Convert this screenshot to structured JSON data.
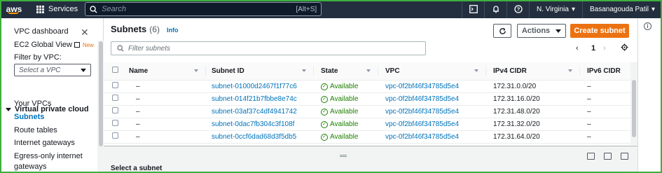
{
  "topbar": {
    "logo": "aws",
    "services_label": "Services",
    "search_placeholder": "Search",
    "search_shortcut": "[Alt+S]",
    "region": "N. Virginia",
    "user": "Basanagouda Patil"
  },
  "sidebar": {
    "dashboard": "VPC dashboard",
    "ec2_global_view": "EC2 Global View",
    "new_badge": "New",
    "filter_label": "Filter by VPC:",
    "filter_placeholder": "Select a VPC",
    "section": "Virtual private cloud",
    "items": [
      "Your VPCs",
      "Subnets",
      "Route tables",
      "Internet gateways",
      "Egress-only internet gateways"
    ],
    "active_item": "Subnets"
  },
  "panel": {
    "title": "Subnets",
    "count": "(6)",
    "info": "Info",
    "actions_label": "Actions",
    "create_label": "Create subnet",
    "filter_placeholder": "Filter subnets",
    "page_number": "1"
  },
  "table": {
    "columns": [
      "Name",
      "Subnet ID",
      "State",
      "VPC",
      "IPv4 CIDR",
      "IPv6 CIDR"
    ],
    "rows": [
      {
        "name": "–",
        "subnet_id": "subnet-01000d2467f1f77c6",
        "state": "Available",
        "vpc": "vpc-0f2bf46f34785d5e4",
        "ipv4": "172.31.0.0/20",
        "ipv6": "–"
      },
      {
        "name": "–",
        "subnet_id": "subnet-014f21b7fbbe8e74c",
        "state": "Available",
        "vpc": "vpc-0f2bf46f34785d5e4",
        "ipv4": "172.31.16.0/20",
        "ipv6": "–"
      },
      {
        "name": "–",
        "subnet_id": "subnet-03af37c4df4941742",
        "state": "Available",
        "vpc": "vpc-0f2bf46f34785d5e4",
        "ipv4": "172.31.48.0/20",
        "ipv6": "–"
      },
      {
        "name": "–",
        "subnet_id": "subnet-0dac7fb304c3f108f",
        "state": "Available",
        "vpc": "vpc-0f2bf46f34785d5e4",
        "ipv4": "172.31.32.0/20",
        "ipv6": "–"
      },
      {
        "name": "–",
        "subnet_id": "subnet-0ccf6dad68d3f5db5",
        "state": "Available",
        "vpc": "vpc-0f2bf46f34785d5e4",
        "ipv4": "172.31.64.0/20",
        "ipv6": "–"
      }
    ]
  },
  "detail": {
    "title": "Select a subnet"
  },
  "colors": {
    "topbar_bg": "#232f3e",
    "accent_orange": "#ec7211",
    "link_blue": "#0073bb",
    "available_green": "#1d8102"
  }
}
